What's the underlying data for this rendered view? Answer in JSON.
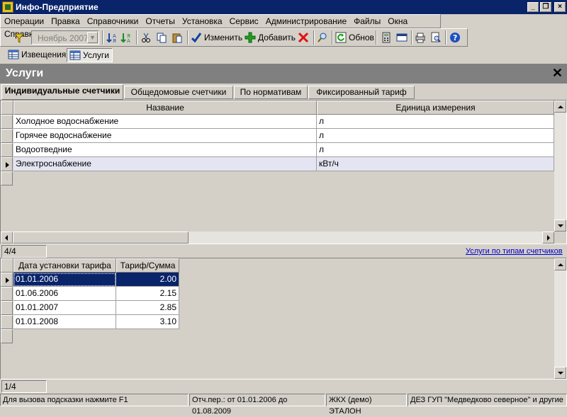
{
  "window": {
    "title": "Инфо-Предприятие",
    "minimize": "_",
    "restore": "❐",
    "close": "×"
  },
  "menu": [
    "Операции",
    "Правка",
    "Справочники",
    "Отчеты",
    "Установка",
    "Сервис",
    "Администрирование",
    "Файлы",
    "Окна",
    "Справка"
  ],
  "toolbar": {
    "period": "Ноябрь 2007",
    "edit_label": "Изменить",
    "add_label": "Добавить",
    "refresh_label": "Обнов"
  },
  "window_tabs": [
    "Извещения",
    "Услуги"
  ],
  "page": {
    "title": "Услуги",
    "close": "✕"
  },
  "tabs": [
    "Индивидуальные счетчики",
    "Общедомовые счетчики",
    "По нормативам",
    "Фиксированный тариф"
  ],
  "services_table": {
    "columns": [
      "Название",
      "Единица измерения"
    ],
    "rows": [
      [
        "Холодное водоснабжение",
        "л"
      ],
      [
        "Горячее водоснабжение",
        "л"
      ],
      [
        "Водоотведние",
        "л"
      ],
      [
        "Электроснабжение",
        "кВт/ч"
      ]
    ],
    "counter": "4/4",
    "link": "Услуги по типам счетчиков"
  },
  "tariff_table": {
    "columns": [
      "Дата установки тарифа",
      "Тариф/Сумма"
    ],
    "rows": [
      [
        "01.01.2006",
        "2.00"
      ],
      [
        "01.06.2006",
        "2.15"
      ],
      [
        "01.01.2007",
        "2.85"
      ],
      [
        "01.01.2008",
        "3.10"
      ]
    ],
    "counter": "1/4"
  },
  "statusbar": {
    "hint": "Для вызова подсказки нажмите F1",
    "period": "Отч.пер.: от 01.01.2006 до 01.08.2009",
    "db": "ЖКХ (демо) ЭТАЛОН",
    "org": "ДЕЗ ГУП \"Медведково северное\" и другие"
  }
}
